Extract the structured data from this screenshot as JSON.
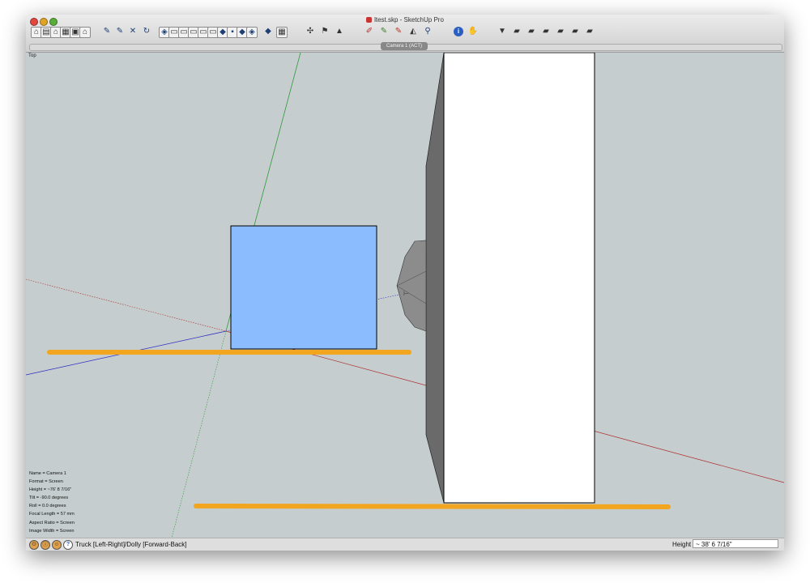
{
  "window": {
    "title": "ltest.skp - SketchUp Pro",
    "traffic_lights": [
      "close",
      "minimize",
      "zoom"
    ]
  },
  "toolbar": {
    "groups": [
      [
        "get-models-icon",
        "share-model-icon",
        "warehouse-home-icon",
        "share-component-icon",
        "get-photo-icon",
        "house-icon"
      ],
      [
        "push-pin-icon",
        "push-pin-2-icon",
        "cross-icon",
        "rotate-icon"
      ],
      [
        "iso-view-icon",
        "top-view-icon",
        "front-view-icon",
        "right-view-icon",
        "back-view-icon",
        "left-view-icon",
        "bottom-view-icon",
        "xray-icon"
      ],
      [
        "back-edges-icon",
        "paint-icon"
      ],
      [
        "match-photo-icon",
        "advanced-camera-icon",
        "camera-frustum-icon"
      ],
      [
        "pencil-icon",
        "pencil-green-icon",
        "pencil-red-icon",
        "axes-icon",
        "magnifier-icon"
      ],
      [
        "info-icon",
        "hand-icon"
      ],
      [
        "scene-icon",
        "layer-icon",
        "layer-2-icon",
        "layer-3-icon",
        "layer-4-icon",
        "layer-5-icon",
        "layer-6-icon"
      ]
    ]
  },
  "scenes": {
    "active_tab": "Camera 1 (ACT)"
  },
  "viewport": {
    "view_label": "Top",
    "background": "#c5cdce",
    "camera_info": [
      "Name = Camera 1",
      "Format = Screen",
      "Height = ~76' 8 7/16\"",
      "Tilt = -90.0 degrees",
      "Roll = 0.0 degrees",
      "Focal Length = 57 mm",
      "Aspect Ratio = Screen",
      "Image Width = Screen"
    ],
    "colors": {
      "blue_face": "#8bbcfd",
      "orange_bar": "#f2a51e",
      "grey_face": "#6a6a6a",
      "axis_red": "#b02a2a",
      "axis_green": "#2f9a3a",
      "axis_blue": "#2d2dc0"
    }
  },
  "statusbar": {
    "hint": "Truck [Left-Right]/Dolly [Forward-Back]",
    "measure_label": "Height",
    "measure_value": "~ 38' 6 7/16\"",
    "icons": [
      "geo-location-icon",
      "credits-icon",
      "user-icon",
      "help-icon"
    ]
  }
}
